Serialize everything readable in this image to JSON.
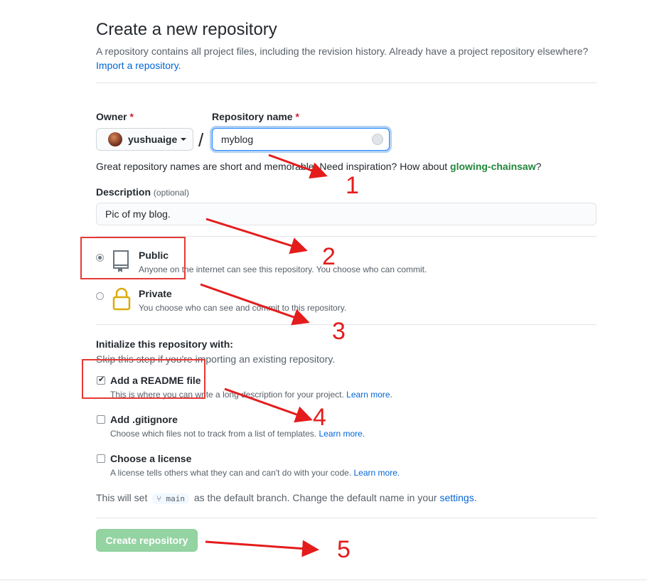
{
  "header": {
    "title": "Create a new repository",
    "subtitle": "A repository contains all project files, including the revision history. Already have a project repository elsewhere?",
    "import_link": "Import a repository",
    "import_suffix": "."
  },
  "owner": {
    "label": "Owner",
    "required_mark": "*",
    "value": "yushuaige"
  },
  "repo_name": {
    "label": "Repository name",
    "required_mark": "*",
    "value": "myblog",
    "separator": "/"
  },
  "hint": {
    "text": "Great repository names are short and memorable. Need inspiration? How about",
    "suggestion": "glowing-chainsaw",
    "suffix": "?"
  },
  "description": {
    "label": "Description",
    "optional": "(optional)",
    "value": "Pic of my blog."
  },
  "visibility": {
    "options": [
      {
        "title": "Public",
        "desc": "Anyone on the internet can see this repository. You choose who can commit.",
        "selected": true
      },
      {
        "title": "Private",
        "desc": "You choose who can see and commit to this repository.",
        "selected": false
      }
    ]
  },
  "init": {
    "heading": "Initialize this repository with:",
    "subheading": "Skip this step if you're importing an existing repository.",
    "options": [
      {
        "title": "Add a README file",
        "desc": "This is where you can write a long description for your project.",
        "link": "Learn more.",
        "checked": true
      },
      {
        "title": "Add .gitignore",
        "desc": "Choose which files not to track from a list of templates.",
        "link": "Learn more.",
        "checked": false
      },
      {
        "title": "Choose a license",
        "desc": "A license tells others what they can and can't do with your code.",
        "link": "Learn more.",
        "checked": false
      }
    ]
  },
  "branch": {
    "prefix": "This will set",
    "name": "main",
    "middle": "as the default branch. Change the default name in your",
    "link": "settings",
    "suffix": "."
  },
  "submit": {
    "label": "Create repository"
  },
  "annotations": {
    "numbers": [
      "1",
      "2",
      "3",
      "4",
      "5"
    ],
    "color": "#e41c1c"
  }
}
